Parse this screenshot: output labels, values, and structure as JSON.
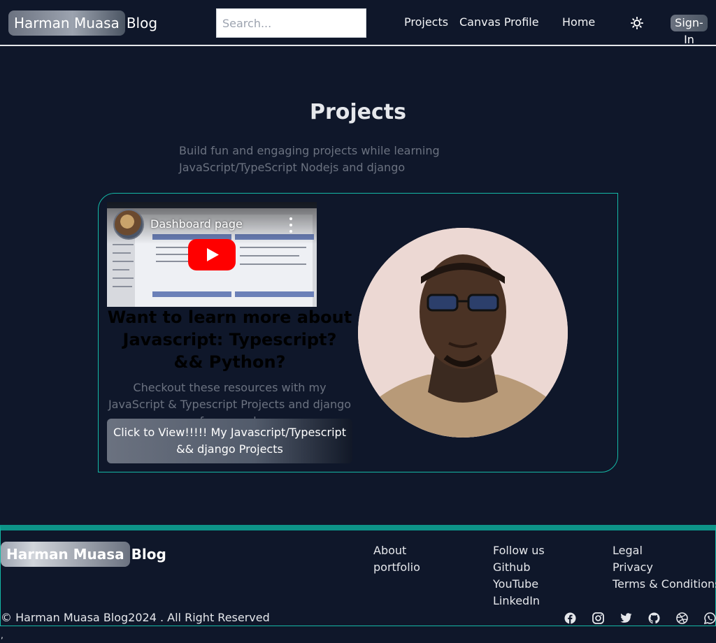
{
  "navbar": {
    "brand_highlight": "Harman Muasa",
    "brand_rest": "Blog",
    "search_placeholder": "Search...",
    "links": [
      "Projects",
      "Canvas Profile",
      "Home"
    ],
    "theme_icon": "sun-icon",
    "signin_label": "Sign-In"
  },
  "main": {
    "title": "Projects",
    "subtitle": "Build fun and engaging projects while learning JavaScript/TypeScript Nodejs and django",
    "card": {
      "video_title": "Dashboard page",
      "learn_title": "Want to learn more about Javascript: Typescript? && Python?",
      "learn_text": "Checkout these resources with my JavaScript & Typescript Projects and django framework",
      "button_label": "Click to View!!!!! My Javascript/Typescript && django Projects"
    }
  },
  "footer": {
    "brand_highlight": "Harman Muasa",
    "brand_rest": "Blog",
    "col1": [
      "About",
      "portfolio"
    ],
    "col2": [
      "Follow us",
      "Github",
      "YouTube",
      "LinkedIn"
    ],
    "col3": [
      "Legal",
      "Privacy",
      "Terms & Conditions"
    ],
    "copyright": "© Harman Muasa Blog2024 . All Right Reserved",
    "socials": [
      "facebook-icon",
      "instagram-icon",
      "twitter-icon",
      "github-icon",
      "dribbble-icon",
      "whatsapp-icon"
    ]
  },
  "trailing_text": ","
}
